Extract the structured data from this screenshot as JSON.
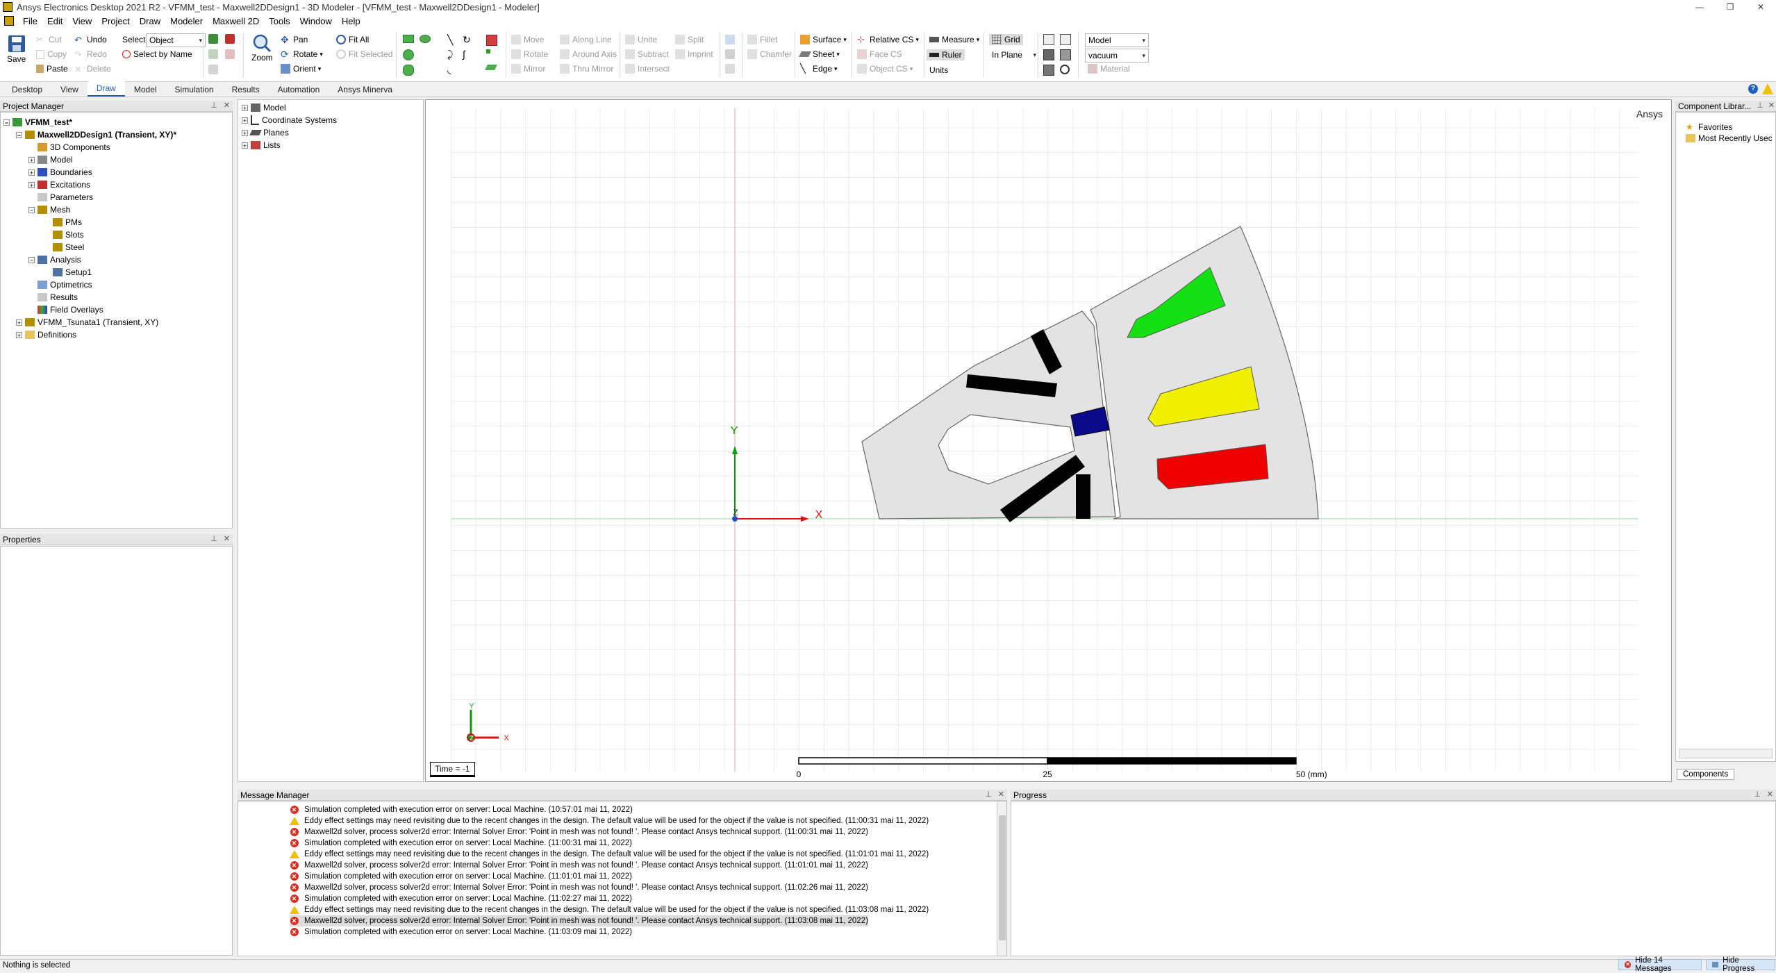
{
  "window": {
    "title": "Ansys Electronics Desktop 2021 R2 - VFMM_test - Maxwell2DDesign1 - 3D Modeler - [VFMM_test - Maxwell2DDesign1 - Modeler]",
    "minimize": "—",
    "restore": "❐",
    "close": "✕"
  },
  "menu": [
    "File",
    "Edit",
    "View",
    "Project",
    "Draw",
    "Modeler",
    "Maxwell 2D",
    "Tools",
    "Window",
    "Help"
  ],
  "ribbon": {
    "save": "Save",
    "cut": "Cut",
    "copy": "Copy",
    "paste": "Paste",
    "undo": "Undo",
    "redo": "Redo",
    "delete": "Delete",
    "select_label": "Select:",
    "select_value": "Object",
    "select_by_name": "Select by Name",
    "zoom": "Zoom",
    "pan": "Pan",
    "rotate": "Rotate",
    "orient": "Orient",
    "fit_all": "Fit All",
    "fit_selected": "Fit Selected",
    "move": "Move",
    "rotate2": "Rotate",
    "mirror": "Mirror",
    "along_line": "Along Line",
    "around_axis": "Around Axis",
    "thru_mirror": "Thru Mirror",
    "unite": "Unite",
    "subtract": "Subtract",
    "intersect": "Intersect",
    "split": "Split",
    "imprint": "Imprint",
    "fillet": "Fillet",
    "chamfer": "Chamfer",
    "surface": "Surface",
    "sheet": "Sheet",
    "edge": "Edge",
    "relative_cs": "Relative CS",
    "face_cs": "Face CS",
    "object_cs": "Object CS",
    "measure": "Measure",
    "ruler": "Ruler",
    "units": "Units",
    "grid": "Grid",
    "in_plane": "In Plane",
    "model_dd": "Model",
    "material_dd": "vacuum",
    "material": "Material"
  },
  "tabs": [
    "Desktop",
    "View",
    "Draw",
    "Model",
    "Simulation",
    "Results",
    "Automation",
    "Ansys Minerva"
  ],
  "active_tab": "Draw",
  "project_manager": {
    "title": "Project Manager",
    "items": [
      {
        "label": "VFMM_test*",
        "bold": true
      },
      {
        "label": "Maxwell2DDesign1 (Transient, XY)*",
        "bold": true
      },
      {
        "label": "3D Components"
      },
      {
        "label": "Model"
      },
      {
        "label": "Boundaries"
      },
      {
        "label": "Excitations"
      },
      {
        "label": "Parameters"
      },
      {
        "label": "Mesh"
      },
      {
        "label": "PMs"
      },
      {
        "label": "Slots"
      },
      {
        "label": "Steel"
      },
      {
        "label": "Analysis"
      },
      {
        "label": "Setup1"
      },
      {
        "label": "Optimetrics"
      },
      {
        "label": "Results"
      },
      {
        "label": "Field Overlays"
      },
      {
        "label": "VFMM_Tsunata1 (Transient, XY)"
      },
      {
        "label": "Definitions"
      }
    ]
  },
  "properties": {
    "title": "Properties"
  },
  "model_tree": {
    "items": [
      "Model",
      "Coordinate Systems",
      "Planes",
      "Lists"
    ]
  },
  "viewport": {
    "watermark": "Ansys",
    "time_label": "Time = -1",
    "axis_x": "X",
    "axis_y": "Y",
    "axis_z": "Z",
    "mini_y": "Y",
    "mini_x": "X",
    "mini_z": "Z",
    "scale_labels": [
      "0",
      "25",
      "50 (mm)"
    ],
    "colors": {
      "green": "#14e014",
      "yellow": "#f0f000",
      "red": "#ee0000",
      "blue": "#0a0a8a",
      "steel": "#e3e3e3"
    }
  },
  "component_library": {
    "title": "Component Librar...",
    "items": [
      "Favorites",
      "Most Recently Usec"
    ],
    "tab": "Components"
  },
  "message_manager": {
    "title": "Message Manager",
    "messages": [
      {
        "type": "error",
        "text": "Simulation completed with execution error on server: Local Machine. (10:57:01  mai 11, 2022)"
      },
      {
        "type": "warning",
        "text": "Eddy effect settings may need revisiting due to the recent changes in the design.  The default value will be used for the object if the value is not specified.  (11:00:31  mai 11, 2022)"
      },
      {
        "type": "error",
        "text": "Maxwell2d solver, process solver2d error: Internal Solver Error:  'Point in mesh was not found! '. Please contact Ansys technical support.  (11:00:31  mai 11, 2022)"
      },
      {
        "type": "error",
        "text": "Simulation completed with execution error on server: Local Machine. (11:00:31  mai 11, 2022)"
      },
      {
        "type": "warning",
        "text": "Eddy effect settings may need revisiting due to the recent changes in the design.  The default value will be used for the object if the value is not specified.  (11:01:01  mai 11, 2022)"
      },
      {
        "type": "error",
        "text": "Maxwell2d solver, process solver2d error: Internal Solver Error:  'Point in mesh was not found! '. Please contact Ansys technical support.  (11:01:01  mai 11, 2022)"
      },
      {
        "type": "error",
        "text": "Simulation completed with execution error on server: Local Machine. (11:01:01  mai 11, 2022)"
      },
      {
        "type": "error",
        "text": "Maxwell2d solver, process solver2d error: Internal Solver Error:  'Point in mesh was not found! '. Please contact Ansys technical support.  (11:02:26  mai 11, 2022)"
      },
      {
        "type": "error",
        "text": "Simulation completed with execution error on server: Local Machine. (11:02:27  mai 11, 2022)"
      },
      {
        "type": "warning",
        "text": "Eddy effect settings may need revisiting due to the recent changes in the design.  The default value will be used for the object if the value is not specified.  (11:03:08  mai 11, 2022)"
      },
      {
        "type": "error",
        "text": "Maxwell2d solver, process solver2d error: Internal Solver Error:  'Point in mesh was not found! '. Please contact Ansys technical support.  (11:03:08  mai 11, 2022)",
        "selected": true
      },
      {
        "type": "error",
        "text": "Simulation completed with execution error on server: Local Machine. (11:03:09  mai 11, 2022)"
      }
    ]
  },
  "progress": {
    "title": "Progress"
  },
  "status": {
    "text": "Nothing is selected",
    "hide_messages": "Hide 14 Messages",
    "hide_progress": "Hide Progress"
  }
}
